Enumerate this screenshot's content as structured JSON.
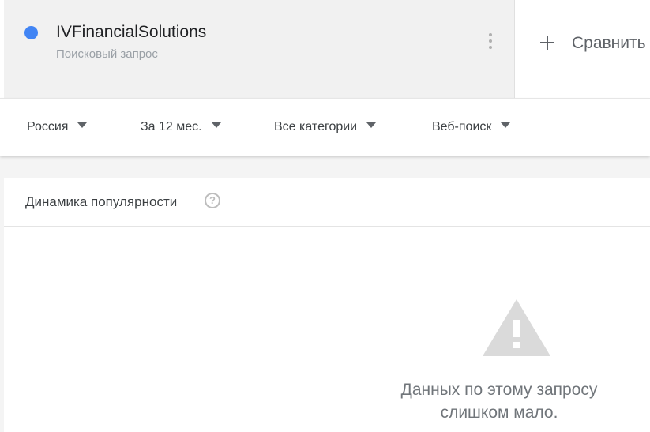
{
  "term": {
    "name": "IVFinancialSolutions",
    "type": "Поисковый запрос",
    "dot_color": "#4285f4",
    "menu_icon": "more-vert-icon"
  },
  "compare": {
    "icon": "plus-icon",
    "label": "Сравнить"
  },
  "filters": [
    {
      "label": "Россия"
    },
    {
      "label": "За 12 мес."
    },
    {
      "label": "Все категории"
    },
    {
      "label": "Веб-поиск"
    }
  ],
  "panel": {
    "title": "Динамика популярности",
    "help_icon_glyph": "?",
    "warning_icon": "warning-icon",
    "message_line1": "Данных по этому запросу",
    "message_line2": "слишком мало."
  },
  "colors": {
    "accent_blue": "#4285f4",
    "warning_gray": "#dadada"
  }
}
